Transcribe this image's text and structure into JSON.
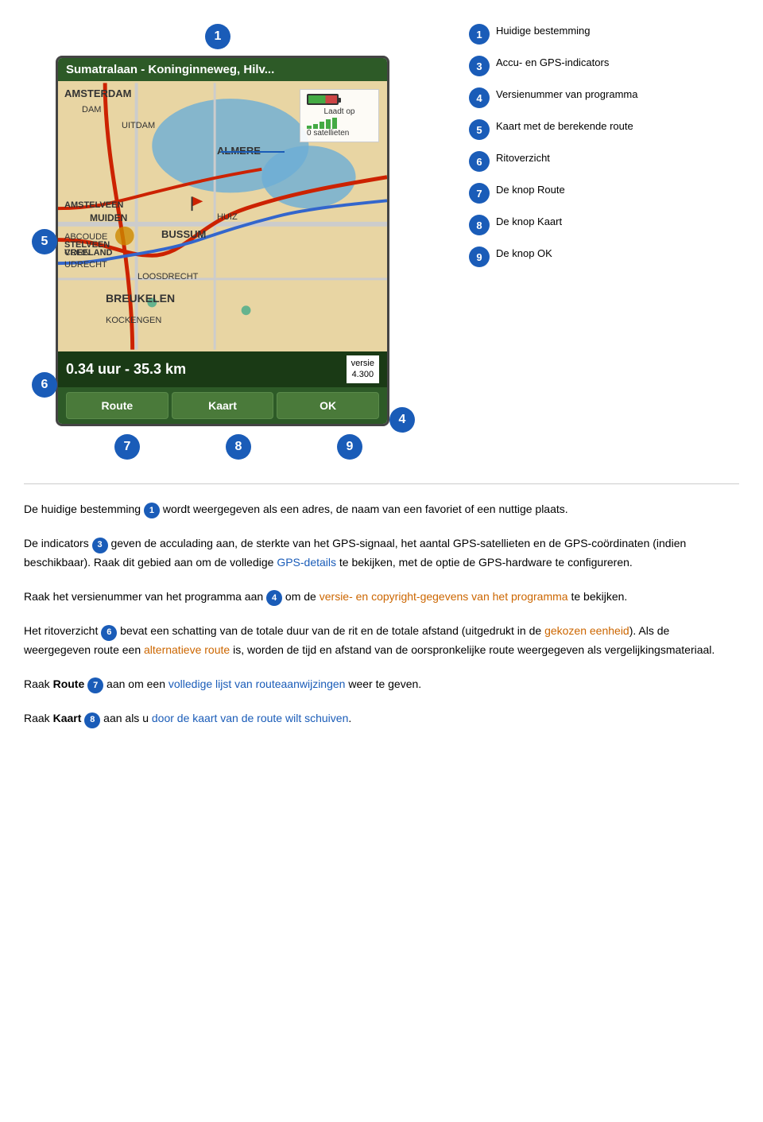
{
  "device": {
    "title": "Sumatralaan - Koninginneweg, Hilv...",
    "gps_overlay": {
      "label_top": "Laadt op",
      "label_bottom": "0 satellieten"
    },
    "trip_info": "0.34 uur - 35.3 km",
    "version": "versie\n4.300",
    "buttons": [
      "Route",
      "Kaart",
      "OK"
    ]
  },
  "legend": [
    {
      "number": "1",
      "text": "Huidige bestemming"
    },
    {
      "number": "3",
      "text": "Accu- en GPS-indicators"
    },
    {
      "number": "4",
      "text": "Versienummer van programma"
    },
    {
      "number": "5",
      "text": "Kaart met de berekende route"
    },
    {
      "number": "6",
      "text": "Ritoverzicht"
    },
    {
      "number": "7",
      "text": "De knop Route"
    },
    {
      "number": "8",
      "text": "De knop Kaart"
    },
    {
      "number": "9",
      "text": "De knop OK"
    }
  ],
  "callouts_below": [
    "7",
    "8",
    "9"
  ],
  "descriptions": [
    {
      "id": "desc1",
      "text_parts": [
        {
          "type": "normal",
          "text": "De huidige bestemming "
        },
        {
          "type": "circle",
          "number": "1"
        },
        {
          "type": "normal",
          "text": " wordt weergegeven als een adres, de naam van een favoriet of een nuttige plaats."
        }
      ]
    },
    {
      "id": "desc3",
      "text_parts": [
        {
          "type": "normal",
          "text": "De indicators "
        },
        {
          "type": "circle",
          "number": "3"
        },
        {
          "type": "normal",
          "text": " geven de acculading aan, de sterkte van het GPS-signaal, het aantal GPS-satellieten en de GPS-coördinaten (indien beschikbaar). Raak dit gebied aan om de volledige "
        },
        {
          "type": "link-blue",
          "text": "GPS-details"
        },
        {
          "type": "normal",
          "text": " te bekijken, met de optie de GPS-hardware te configureren."
        }
      ]
    },
    {
      "id": "desc4",
      "text_parts": [
        {
          "type": "normal",
          "text": "Raak het versienummer van het programma aan "
        },
        {
          "type": "circle",
          "number": "4"
        },
        {
          "type": "normal",
          "text": " om de "
        },
        {
          "type": "link-orange",
          "text": "versie- en copyright-gegevens van het programma"
        },
        {
          "type": "normal",
          "text": " te bekijken."
        }
      ]
    },
    {
      "id": "desc6",
      "text_parts": [
        {
          "type": "normal",
          "text": "Het ritoverzicht "
        },
        {
          "type": "circle",
          "number": "6"
        },
        {
          "type": "normal",
          "text": " bevat een schatting van de totale duur van de rit en de totale afstand (uitgedrukt in de "
        },
        {
          "type": "link-orange",
          "text": "gekozen eenheid"
        },
        {
          "type": "normal",
          "text": "). Als de weergegeven route een "
        },
        {
          "type": "link-orange",
          "text": "alternatieve route"
        },
        {
          "type": "normal",
          "text": " is, worden de tijd en afstand van de oorspronkelijke route weergegeven als vergelijkingsmateriaal."
        }
      ]
    },
    {
      "id": "desc7",
      "text_parts": [
        {
          "type": "normal",
          "text": "Raak "
        },
        {
          "type": "bold",
          "text": "Route"
        },
        {
          "type": "circle",
          "number": "7"
        },
        {
          "type": "normal",
          "text": " aan om een "
        },
        {
          "type": "link-blue",
          "text": "volledige lijst van routeaanwijzingen"
        },
        {
          "type": "normal",
          "text": " weer te geven."
        }
      ]
    },
    {
      "id": "desc8",
      "text_parts": [
        {
          "type": "normal",
          "text": "Raak "
        },
        {
          "type": "bold",
          "text": "Kaart"
        },
        {
          "type": "circle",
          "number": "8"
        },
        {
          "type": "normal",
          "text": " aan als u "
        },
        {
          "type": "link-blue",
          "text": "door de kaart van de route wilt schuiven"
        },
        {
          "type": "normal",
          "text": "."
        }
      ]
    }
  ]
}
